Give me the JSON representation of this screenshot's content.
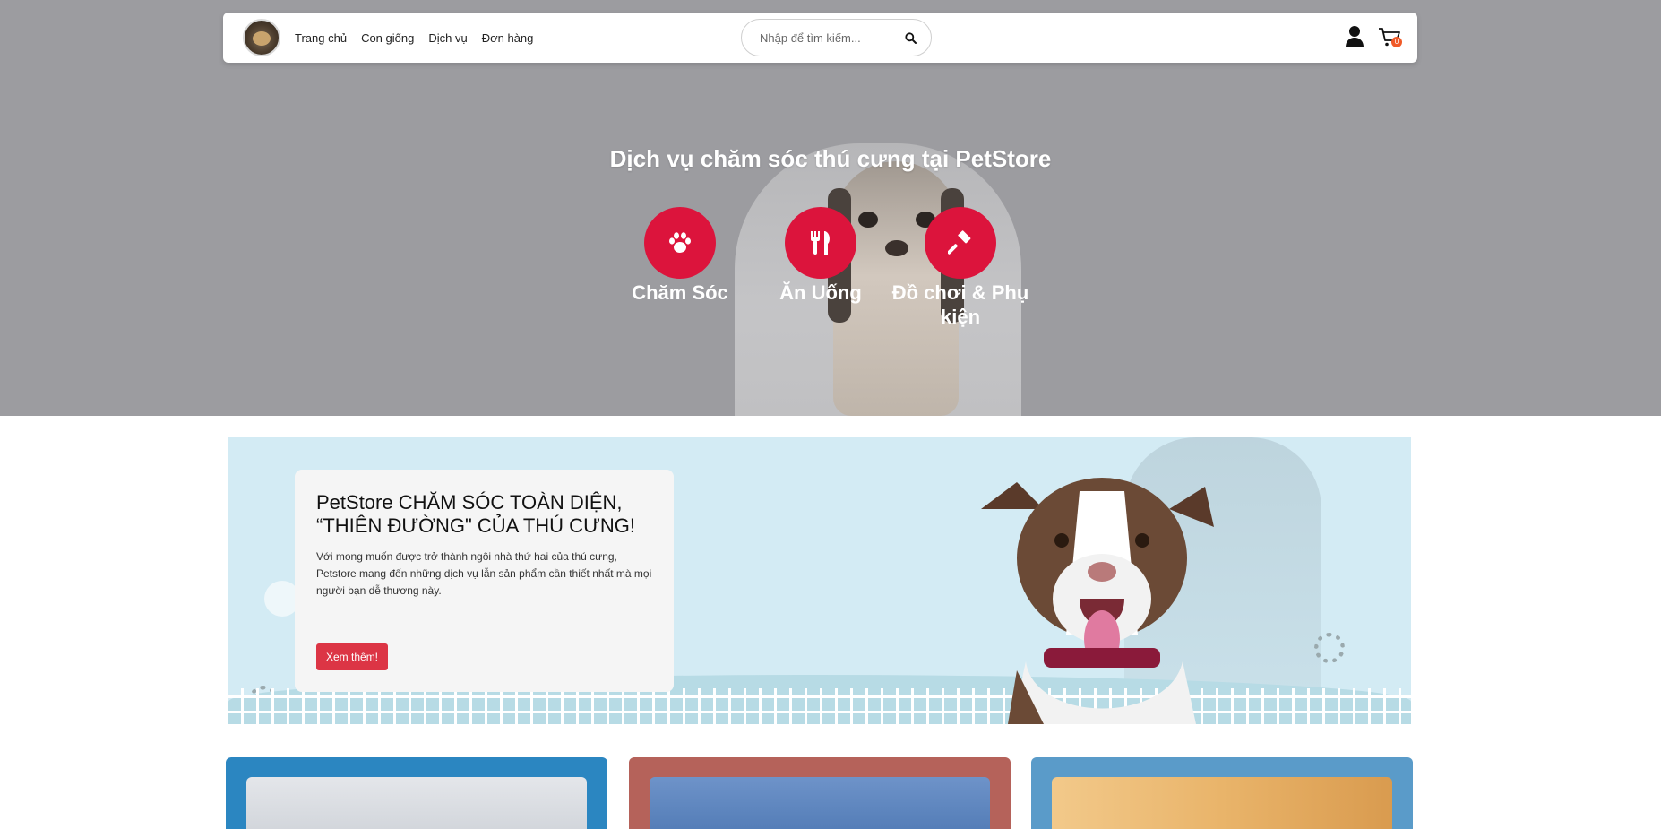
{
  "nav": {
    "links": [
      "Trang chủ",
      "Con giống",
      "Dịch vụ",
      "Đơn hàng"
    ],
    "search_placeholder": "Nhập để tìm kiếm...",
    "cart_count": "0",
    "icons": [
      "logo-avatar",
      "search-icon",
      "user-icon",
      "cart-icon"
    ]
  },
  "hero": {
    "title": "Dịch vụ chăm sóc thú cưng tại PetStore",
    "services": [
      {
        "label": "Chăm Sóc",
        "icon": "paw-icon"
      },
      {
        "label": "Ăn Uống",
        "icon": "utensils-icon"
      },
      {
        "label": "Đồ chơi & Phụ kiện",
        "icon": "hammer-icon"
      }
    ]
  },
  "banner": {
    "heading": "PetStore CHĂM SÓC TOÀN DIỆN, “THIÊN ĐƯỜNG\" CỦA THÚ CƯNG!",
    "description": "Với mong muốn được trở thành ngôi nhà thứ hai của thú cưng, Petstore mang đến những dịch vụ lẫn sản phẩm cần thiết nhất mà mọi người bạn dễ thương này.",
    "button_label": "Xem thêm!"
  },
  "colors": {
    "accent": "#dc143c",
    "button": "#dc3545",
    "badge": "#f05a28",
    "banner_bg": "#d3ebf4",
    "card_colors": [
      "#2b86c1",
      "#b5625a",
      "#5a9bc9"
    ]
  }
}
